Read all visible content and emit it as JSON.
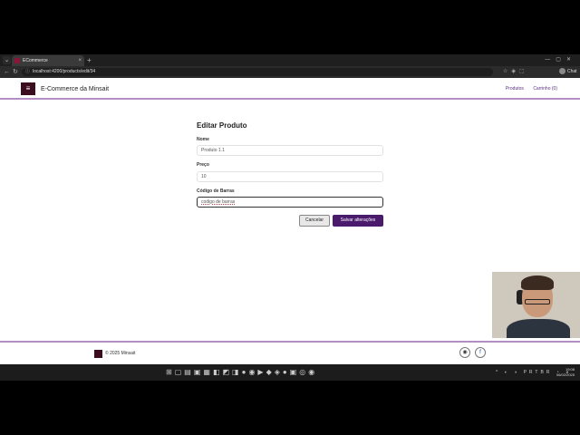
{
  "browser": {
    "tab_title": "ECommerce",
    "url": "localhost:4200/products/edit/34",
    "profile_label": "Chat"
  },
  "header": {
    "brand": "E-Commerce da Minsait",
    "nav": [
      "Produtos",
      "Carrinho (0)"
    ]
  },
  "form": {
    "title": "Editar Produto",
    "fields": [
      {
        "label": "Nome",
        "value": "Produto 1.1"
      },
      {
        "label": "Preço",
        "value": "10"
      },
      {
        "label": "Código de Barras",
        "value": "codigo de barras"
      }
    ],
    "cancel_label": "Cancelar",
    "save_label": "Salvar alterações"
  },
  "footer": {
    "copyright": "© 2025 Minsait",
    "social_icons": [
      "github-icon",
      "facebook-icon"
    ]
  },
  "taskbar": {
    "language": "PRTBR",
    "time": "19:08",
    "date": "06/02/2025"
  },
  "colors": {
    "brand_dark": "#3b0d1e",
    "accent_purple": "#4a1a6d",
    "accent_line": "#b48cc6"
  }
}
